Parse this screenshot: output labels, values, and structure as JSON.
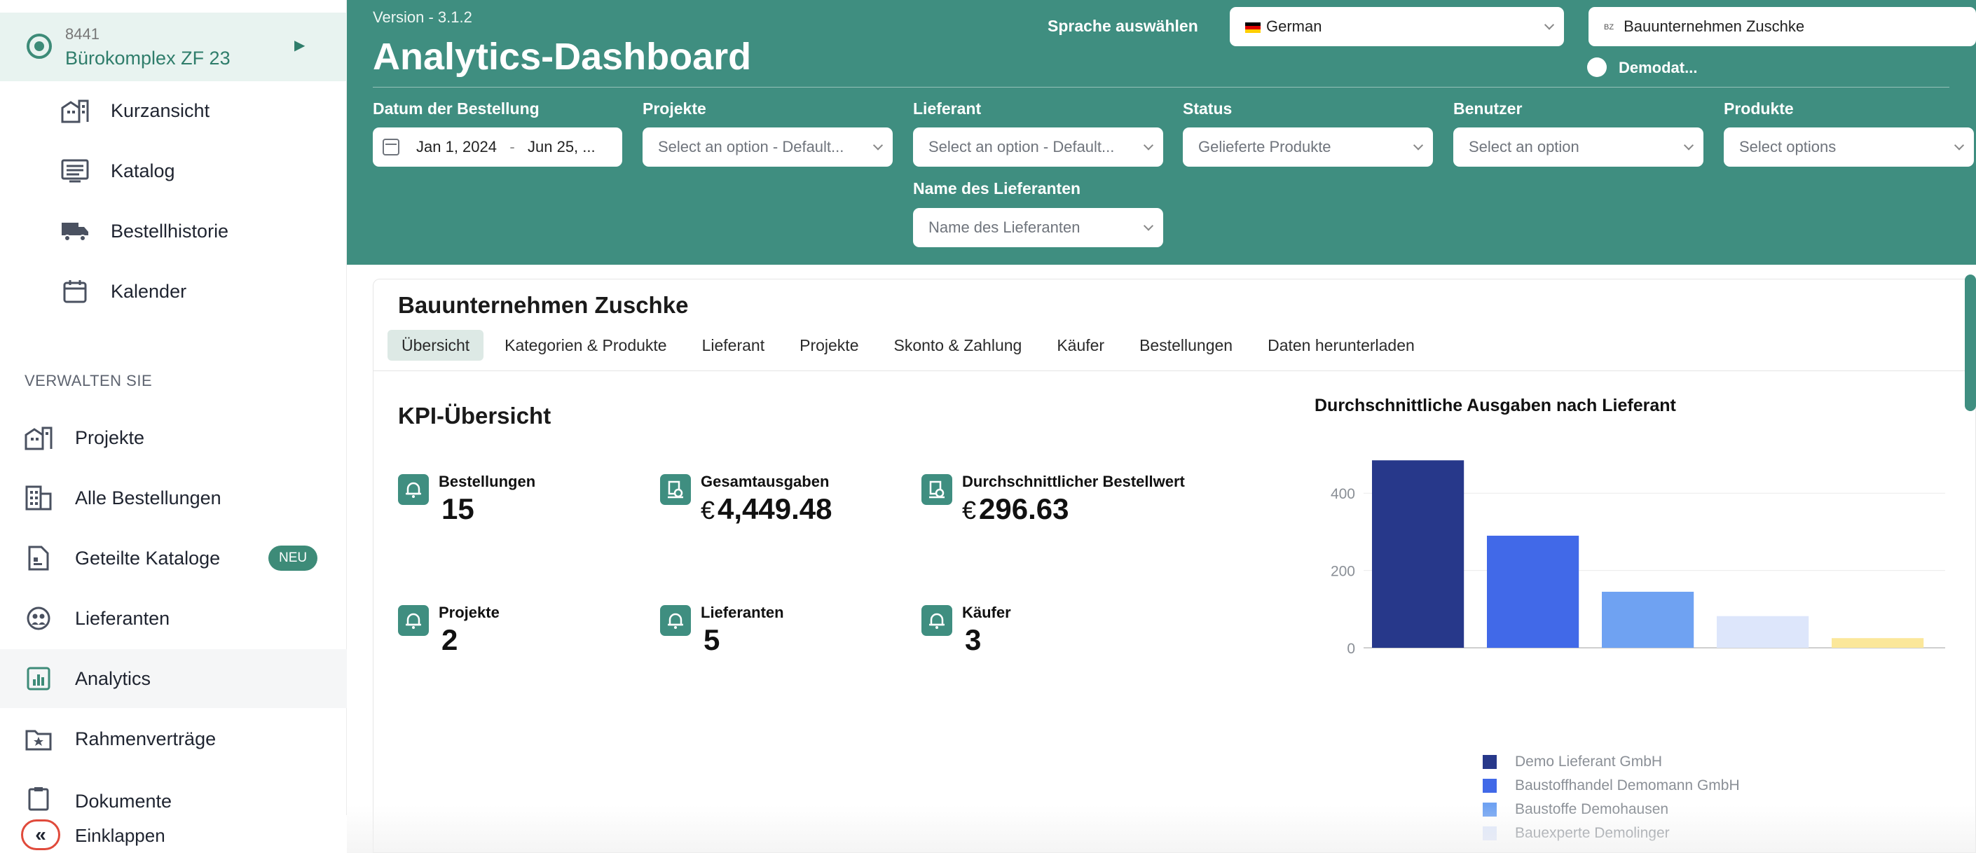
{
  "sidebar": {
    "workspace": {
      "id": "8441",
      "name": "Bürokomplex ZF 23"
    },
    "sub_items": [
      {
        "label": "Kurzansicht",
        "icon": "building-icon"
      },
      {
        "label": "Katalog",
        "icon": "list-icon"
      },
      {
        "label": "Bestellhistorie",
        "icon": "truck-icon"
      },
      {
        "label": "Kalender",
        "icon": "calendar-icon"
      }
    ],
    "section_title": "VERWALTEN SIE",
    "items": [
      {
        "label": "Projekte",
        "icon": "building-icon"
      },
      {
        "label": "Alle Bestellungen",
        "icon": "grid-building-icon"
      },
      {
        "label": "Geteilte Kataloge",
        "icon": "document-icon",
        "badge": "NEU"
      },
      {
        "label": "Lieferanten",
        "icon": "supplier-icon"
      },
      {
        "label": "Analytics",
        "icon": "analytics-icon",
        "active": true
      },
      {
        "label": "Rahmenverträge",
        "icon": "folder-star-icon"
      },
      {
        "label": "Dokumente",
        "icon": "clipboard-icon"
      }
    ],
    "collapse_label": "Einklappen"
  },
  "header": {
    "version": "Version - 3.1.2",
    "title": "Analytics-Dashboard",
    "language_label": "Sprache auswählen",
    "language_value": "German",
    "company_badge": "BZ",
    "company_value": "Bauunternehmen Zuschke",
    "demo_label": "Demodat..."
  },
  "filters": {
    "date": {
      "label": "Datum der Bestellung",
      "from": "Jan 1, 2024",
      "separator": "-",
      "to": "Jun 25, ..."
    },
    "projects": {
      "label": "Projekte",
      "placeholder": "Select an option - Default..."
    },
    "supplier": {
      "label": "Lieferant",
      "placeholder": "Select an option - Default..."
    },
    "status": {
      "label": "Status",
      "placeholder": "Gelieferte Produkte"
    },
    "user": {
      "label": "Benutzer",
      "placeholder": "Select an option"
    },
    "products": {
      "label": "Produkte",
      "placeholder": "Select options"
    },
    "supplier_name": {
      "label": "Name des Lieferanten",
      "placeholder": "Name des Lieferanten"
    }
  },
  "main": {
    "company_title": "Bauunternehmen Zuschke",
    "tabs": [
      {
        "label": "Übersicht",
        "active": true
      },
      {
        "label": "Kategorien & Produkte"
      },
      {
        "label": "Lieferant"
      },
      {
        "label": "Projekte"
      },
      {
        "label": "Skonto & Zahlung"
      },
      {
        "label": "Käufer"
      },
      {
        "label": "Bestellungen"
      },
      {
        "label": "Daten herunterladen"
      }
    ],
    "kpi_title": "KPI-Übersicht",
    "kpis": [
      {
        "label": "Bestellungen",
        "value": "15",
        "currency": ""
      },
      {
        "label": "Gesamtausgaben",
        "value": "4,449.48",
        "currency": "€"
      },
      {
        "label": "Durchschnittlicher Bestellwert",
        "value": "296.63",
        "currency": "€"
      },
      {
        "label": "Projekte",
        "value": "2",
        "currency": ""
      },
      {
        "label": "Lieferanten",
        "value": "5",
        "currency": ""
      },
      {
        "label": "Käufer",
        "value": "3",
        "currency": ""
      }
    ]
  },
  "chart_data": {
    "type": "bar",
    "title": "Durchschnittliche Ausgaben nach Lieferant",
    "categories": [
      "Demo Lieferant GmbH",
      "Baustoffhandel Demomann GmbH",
      "Baustoffe Demohausen",
      "Bauexperte Demolinger",
      ""
    ],
    "values": [
      485,
      290,
      145,
      82,
      25
    ],
    "colors": [
      "#27388a",
      "#4169e8",
      "#6fa2f2",
      "#dde6fb",
      "#fbe79a"
    ],
    "yticks": [
      0,
      200,
      400
    ],
    "ylim": [
      0,
      500
    ],
    "grid": true,
    "legend": "bottom"
  }
}
